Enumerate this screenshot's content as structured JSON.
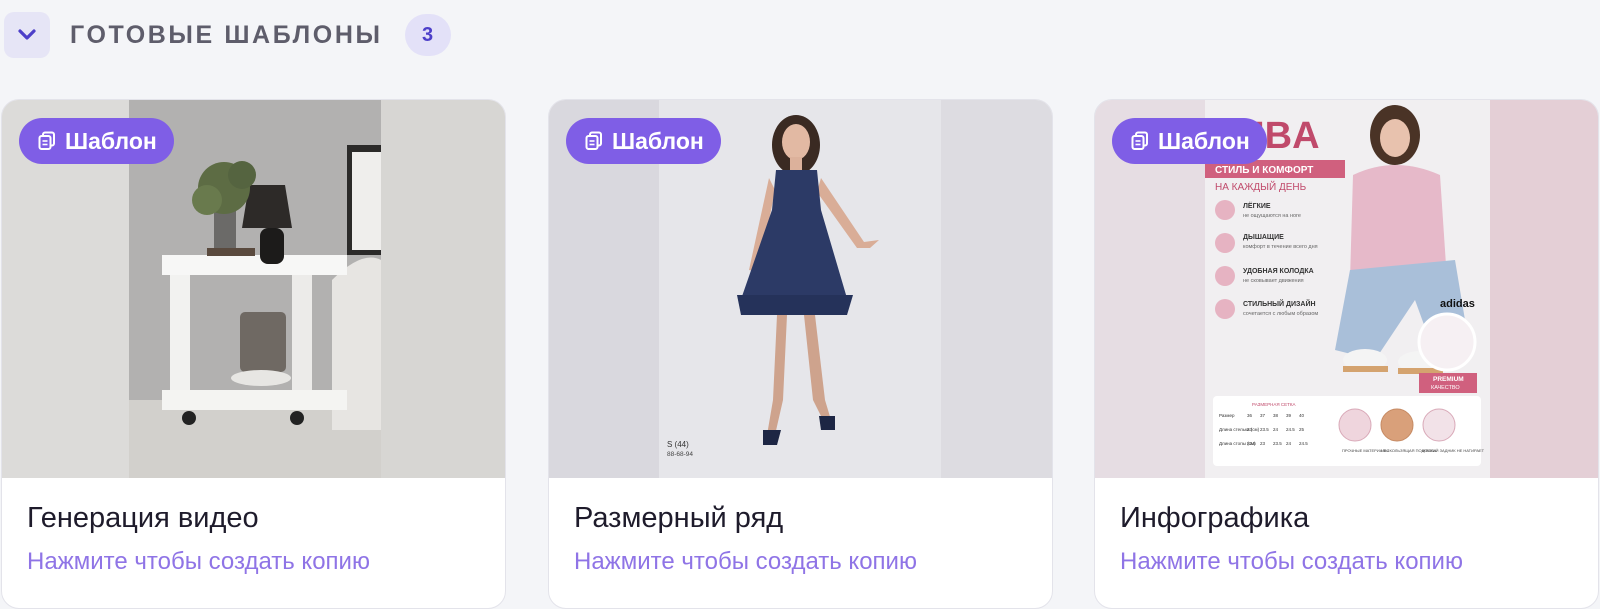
{
  "section": {
    "title": "ГОТОВЫЕ ШАБЛОНЫ",
    "count": "3",
    "collapse_icon": "chevron-down-icon"
  },
  "colors": {
    "accent": "#7f5ee6",
    "subtitle": "#8f74e6",
    "badge_bg": "#e3e1f8",
    "page_bg": "#f4f5f8"
  },
  "cards": [
    {
      "badge": "Шаблон",
      "badge_icon": "copy-icon",
      "title": "Генерация видео",
      "subtitle": "Нажмите чтобы создать копию",
      "image": "white-side-table-with-lamp"
    },
    {
      "badge": "Шаблон",
      "badge_icon": "copy-icon",
      "title": "Размерный ряд",
      "subtitle": "Нажмите чтобы создать копию",
      "image": "woman-in-navy-dress",
      "caption_line1": "S (44)",
      "caption_line2": "88-68-94"
    },
    {
      "badge": "Шаблон",
      "badge_icon": "copy-icon",
      "title": "Инфографика",
      "subtitle": "Нажмите чтобы создать копию",
      "image": "sneaker-infographic",
      "info": {
        "brand_fragment": "MBA",
        "ribbon": "СТИЛЬ И КОМФОРТ",
        "tagline": "НА КАЖДЫЙ ДЕНЬ",
        "features": [
          {
            "title": "ЛЁГКИЕ",
            "text": "не ощущаются на ноге"
          },
          {
            "title": "ДЫШАЩИЕ",
            "text": "комфорт в течение всего дня"
          },
          {
            "title": "УДОБНАЯ КОЛОДКА",
            "text": "не сковывает движения"
          },
          {
            "title": "СТИЛЬНЫЙ ДИЗАЙН",
            "text": "сочетается с любым образом"
          }
        ],
        "logo": "adidas",
        "premium_line1": "PREMIUM",
        "premium_line2": "КАЧЕСТВО",
        "size_table_title": "РАЗМЕРНАЯ СЕТКА",
        "size_headers": [
          "Размер",
          "36",
          "37",
          "38",
          "39",
          "40"
        ],
        "size_row1": [
          "Длина стельки (см)",
          "23",
          "23.5",
          "24",
          "24.5",
          "25"
        ],
        "size_row2": [
          "Длина стопы (см)",
          "22.5",
          "23",
          "23.5",
          "24",
          "24.5"
        ],
        "icon_labels": [
          "ПРОЧНЫЕ МАТЕРИАЛЫ",
          "НЕСКОЛЬЗЯЩАЯ ПОДОШВА",
          "МЯГКИЙ ЗАДНИК НЕ НАТИРАЕТ"
        ]
      }
    }
  ]
}
